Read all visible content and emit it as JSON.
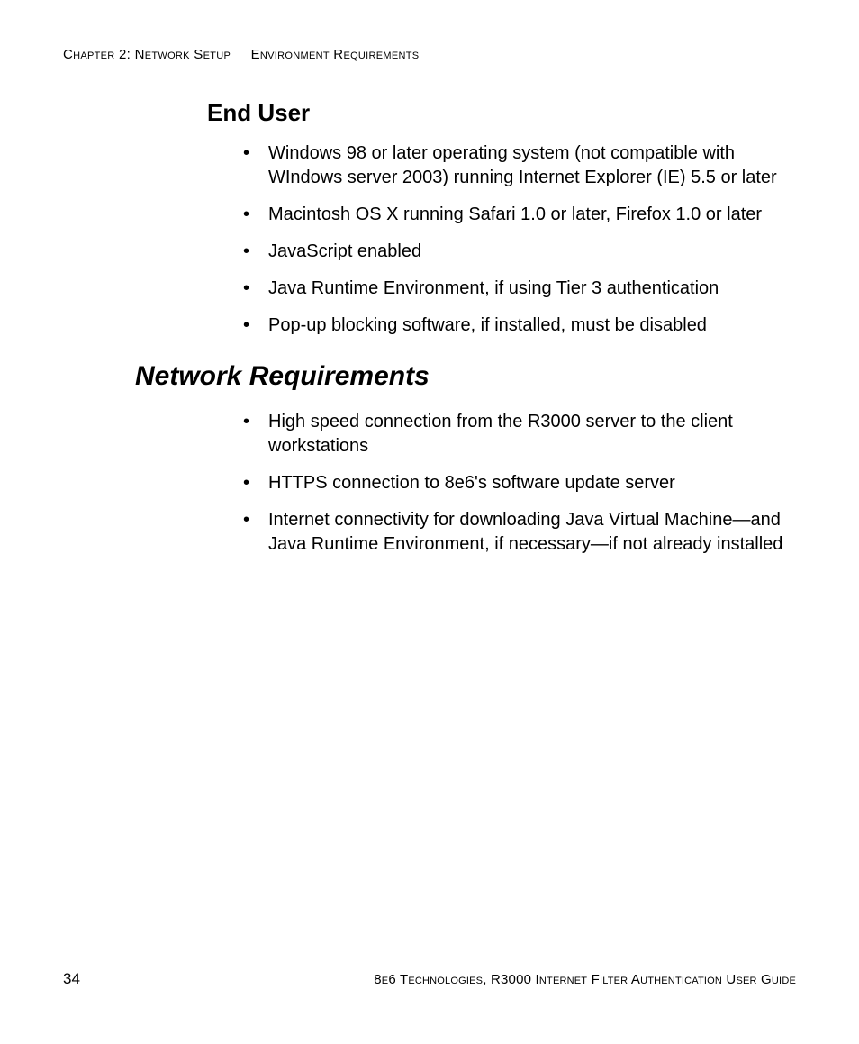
{
  "header": {
    "chapter": "Chapter 2: Network Setup",
    "section": "Environment Requirements"
  },
  "sections": [
    {
      "heading_level": "h3",
      "title": "End User",
      "items": [
        "Windows 98 or later operating system (not compatible with WIndows server 2003) running Internet Explorer (IE) 5.5 or later",
        "Macintosh OS X running Safari 1.0 or later, Firefox 1.0 or later",
        "JavaScript enabled",
        "Java Runtime Environment, if using Tier 3 authentication",
        "Pop-up blocking software, if installed, must be disabled"
      ]
    },
    {
      "heading_level": "h2",
      "title": "Network Requirements",
      "items": [
        "High speed connection from the R3000 server to the client workstations",
        "HTTPS connection to 8e6's software update server",
        "Internet connectivity for downloading Java Virtual Machine—and Java Runtime Environment, if necessary—if not already installed"
      ]
    }
  ],
  "footer": {
    "page_number": "34",
    "doc_title": "8e6 Technologies, R3000 Internet Filter Authentication User Guide"
  }
}
